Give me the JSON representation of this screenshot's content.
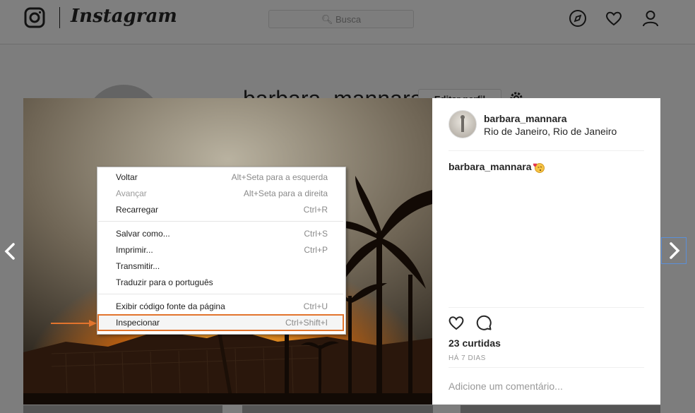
{
  "topbar": {
    "logo_text": "Instagram",
    "search_placeholder": "Busca"
  },
  "background_profile": {
    "username": "barbara_mannara",
    "edit_button": "Editar perfil"
  },
  "post": {
    "username": "barbara_mannara",
    "location": "Rio de Janeiro, Rio de Janeiro",
    "caption_user": "barbara_mannara",
    "likes": "23 curtidas",
    "time_ago": "HÁ 7 DIAS",
    "comment_placeholder": "Adicione um comentário..."
  },
  "context_menu": {
    "items": [
      {
        "label": "Voltar",
        "shortcut": "Alt+Seta para a esquerda"
      },
      {
        "label": "Avançar",
        "shortcut": "Alt+Seta para a direita"
      },
      {
        "label": "Recarregar",
        "shortcut": "Ctrl+R"
      },
      {
        "label": "Salvar como...",
        "shortcut": "Ctrl+S"
      },
      {
        "label": "Imprimir...",
        "shortcut": "Ctrl+P"
      },
      {
        "label": "Transmitir...",
        "shortcut": ""
      },
      {
        "label": "Traduzir para o português",
        "shortcut": ""
      },
      {
        "label": "Exibir código fonte da página",
        "shortcut": "Ctrl+U"
      },
      {
        "label": "Inspecionar",
        "shortcut": "Ctrl+Shift+I"
      }
    ]
  },
  "colors": {
    "highlight": "#e2742d",
    "nav_focus": "#5b8fd9"
  }
}
